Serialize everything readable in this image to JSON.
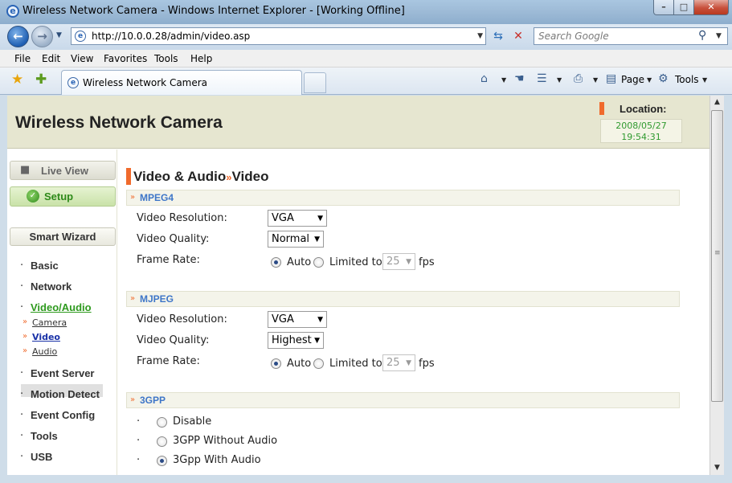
{
  "window": {
    "title": "Wireless Network Camera - Windows Internet Explorer - [Working Offline]",
    "minimize": "–",
    "maximize": "□",
    "close": "✕"
  },
  "navbar": {
    "url": "http://10.0.0.28/admin/video.asp",
    "search_placeholder": "Search Google"
  },
  "menu": [
    "File",
    "Edit",
    "View",
    "Favorites",
    "Tools",
    "Help"
  ],
  "tabs": {
    "active_label": "Wireless Network Camera"
  },
  "commandbar": {
    "page_label": "Page",
    "tools_label": "Tools"
  },
  "header": {
    "site_title": "Wireless Network Camera",
    "location_label": "Location:",
    "date": "2008/05/27",
    "time": "19:54:31"
  },
  "sidebar": {
    "live_view": "Live View",
    "setup": "Setup",
    "smart_wizard": "Smart Wizard",
    "nav": [
      "Basic",
      "Network",
      "Video/Audio",
      "Event Server",
      "Motion Detect",
      "Event Config",
      "Tools",
      "USB"
    ],
    "active_nav": "Video/Audio",
    "sub_items": [
      "Camera",
      "Video",
      "Audio"
    ],
    "active_sub": "Video"
  },
  "content": {
    "title_section": "Video & Audio",
    "title_separator": "»",
    "title_page": "Video",
    "mpeg4": {
      "title": "MPEG4",
      "resolution_label": "Video Resolution:",
      "resolution_value": "VGA",
      "quality_label": "Video Quality:",
      "quality_value": "Normal",
      "frame_rate_label": "Frame Rate:",
      "frame_rate_auto": "Auto",
      "frame_rate_limited": "Limited to",
      "frame_rate_value": "25",
      "frame_rate_unit": "fps"
    },
    "mjpeg": {
      "title": "MJPEG",
      "resolution_label": "Video Resolution:",
      "resolution_value": "VGA",
      "quality_label": "Video Quality:",
      "quality_value": "Highest",
      "frame_rate_label": "Frame Rate:",
      "frame_rate_auto": "Auto",
      "frame_rate_limited": "Limited to",
      "frame_rate_value": "25",
      "frame_rate_unit": "fps"
    },
    "gpp": {
      "title": "3GPP",
      "options": [
        "Disable",
        "3GPP Without Audio",
        "3Gpp With Audio"
      ],
      "selected": "3Gpp With Audio"
    }
  },
  "colors": {
    "accent_orange": "#f06a2c",
    "section_blue": "#3e76c8",
    "active_green": "#2e9a1e",
    "header_bg": "#e6e6d0"
  }
}
